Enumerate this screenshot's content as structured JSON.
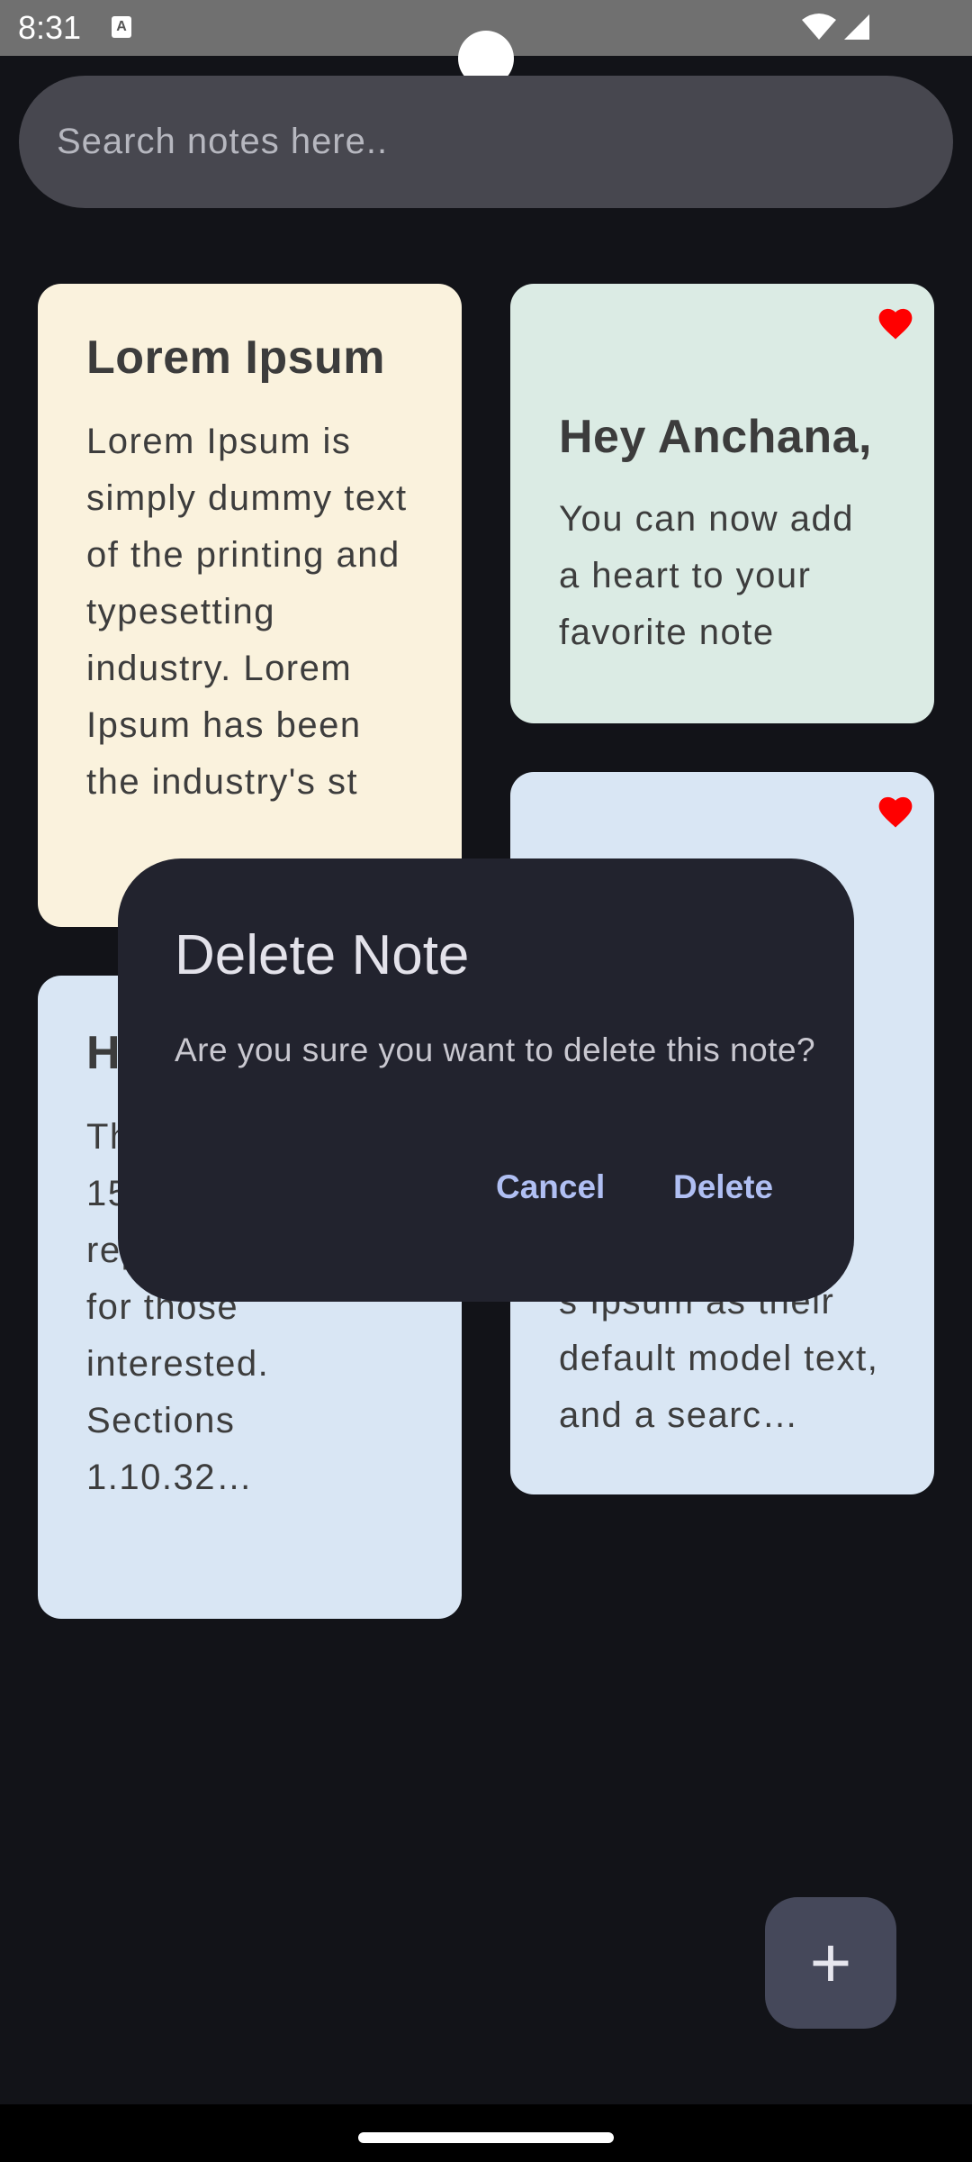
{
  "status_bar": {
    "time": "8:31",
    "notification_icon": "a-icon",
    "wifi_icon": "wifi-icon",
    "signal_icon": "signal-icon"
  },
  "search": {
    "placeholder": "Search notes here.."
  },
  "notes": [
    {
      "title": "Lorem Ipsum",
      "body": "Lorem Ipsum is simply dummy text of the printing and typesetting industry. Lorem Ipsum has been the industry's st",
      "color": "#faf2dd",
      "favorite": false
    },
    {
      "title": "Hey Anchana,",
      "body": "You can now add a heart to your favorite note",
      "color": "#dbebe4",
      "favorite": true
    },
    {
      "title": "H",
      "body": "Th ch Ips the 1500s is reproduced below for those interested. Sections 1.10.32…",
      "color": "#d9e6f4",
      "favorite": false
    },
    {
      "title": "",
      "body": "s Ipsum as their default model text, and a searc…",
      "color": "#d9e6f4",
      "favorite": true
    }
  ],
  "dialog": {
    "title": "Delete Note",
    "message": "Are you sure you want to delete this note?",
    "cancel_label": "Cancel",
    "delete_label": "Delete"
  },
  "fab": {
    "label": "+",
    "icon": "plus-icon"
  },
  "colors": {
    "background": "#121318",
    "heart": "#ff0000",
    "dialog": "#22232e",
    "accent": "#b0bff3"
  }
}
